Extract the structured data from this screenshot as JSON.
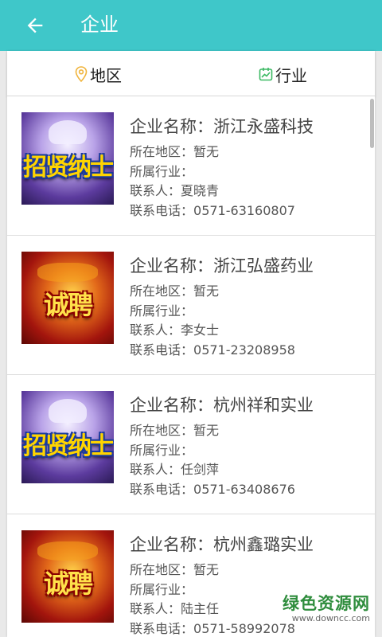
{
  "app_bar": {
    "title": "企业",
    "background": "#3fc7c9"
  },
  "filters": {
    "region": "地区",
    "industry": "行业"
  },
  "labels": {
    "name": "企业名称：",
    "region": "所在地区：",
    "industry": "所属行业：",
    "contact": "联系人：",
    "phone": "联系电话："
  },
  "companies": [
    {
      "name": "浙江永盛科技",
      "region": "暂无",
      "industry": "",
      "contact": "夏晓青",
      "phone": "0571-63160807",
      "image_text": "招贤纳士"
    },
    {
      "name": "浙江弘盛药业",
      "region": "暂无",
      "industry": "",
      "contact": "李女士",
      "phone": "0571-23208958",
      "image_text": "诚聘"
    },
    {
      "name": "杭州祥和实业",
      "region": "暂无",
      "industry": "",
      "contact": "任剑萍",
      "phone": "0571-63408676",
      "image_text": "招贤纳士"
    },
    {
      "name": "杭州鑫璐实业",
      "region": "暂无",
      "industry": "",
      "contact": "陆主任",
      "phone": "0571-58992078",
      "image_text": "诚聘"
    }
  ],
  "watermark": {
    "line1": "绿色资源网",
    "line2": "www.downcc.com"
  }
}
